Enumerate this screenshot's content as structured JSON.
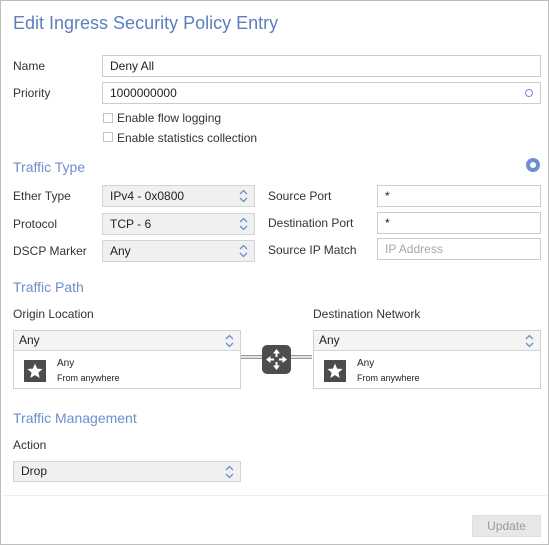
{
  "dialog": {
    "title": "Edit Ingress Security Policy Entry"
  },
  "general": {
    "name_label": "Name",
    "name_value": "Deny All",
    "priority_label": "Priority",
    "priority_value": "1000000000",
    "flow_logging_label": "Enable flow logging",
    "flow_logging_checked": false,
    "stats_label": "Enable statistics collection",
    "stats_checked": false
  },
  "traffic_type": {
    "heading": "Traffic Type",
    "ether_type_label": "Ether Type",
    "ether_type_value": "IPv4 - 0x0800",
    "protocol_label": "Protocol",
    "protocol_value": "TCP - 6",
    "dscp_label": "DSCP Marker",
    "dscp_value": "Any",
    "source_port_label": "Source Port",
    "source_port_value": "*",
    "destination_port_label": "Destination Port",
    "destination_port_value": "*",
    "source_ip_label": "Source IP Match",
    "source_ip_placeholder": "IP Address"
  },
  "traffic_path": {
    "heading": "Traffic Path",
    "origin_label": "Origin Location",
    "origin_value": "Any",
    "origin_card_name": "Any",
    "origin_card_sub": "From anywhere",
    "destination_label": "Destination Network",
    "destination_value": "Any",
    "destination_card_name": "Any",
    "destination_card_sub": "From anywhere"
  },
  "traffic_management": {
    "heading": "Traffic Management",
    "action_label": "Action",
    "action_value": "Drop"
  },
  "footer": {
    "update_label": "Update"
  },
  "colors": {
    "accent": "#6b8fc9",
    "title": "#5b7fbf",
    "icon_dark": "#4c4c4c",
    "disabled_button": "#e7e7e7"
  },
  "icons": [
    "ring-icon",
    "gear-icon",
    "chevron-updown-icon",
    "star-icon",
    "router-icon"
  ]
}
